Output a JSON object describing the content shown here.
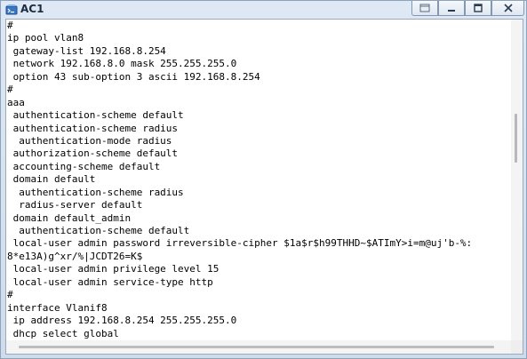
{
  "window": {
    "title": "AC1",
    "controls": {
      "minimize": "minimize",
      "maximize": "maximize",
      "close": "close"
    }
  },
  "terminal": {
    "lines": [
      "#",
      "ip pool vlan8",
      " gateway-list 192.168.8.254",
      " network 192.168.8.0 mask 255.255.255.0",
      " option 43 sub-option 3 ascii 192.168.8.254",
      "#",
      "aaa",
      " authentication-scheme default",
      " authentication-scheme radius",
      "  authentication-mode radius",
      " authorization-scheme default",
      " accounting-scheme default",
      " domain default",
      "  authentication-scheme radius",
      "  radius-server default",
      " domain default_admin",
      "  authentication-scheme default",
      " local-user admin password irreversible-cipher $1a$r$h99THHD~$ATImY>i=m@uj'b-%:",
      "8*e13A)g^xr/%|JCDT26=K$",
      " local-user admin privilege level 15",
      " local-user admin service-type http",
      "#",
      "interface Vlanif8",
      " ip address 192.168.8.254 255.255.255.0",
      " dhcp select global",
      "#"
    ]
  }
}
